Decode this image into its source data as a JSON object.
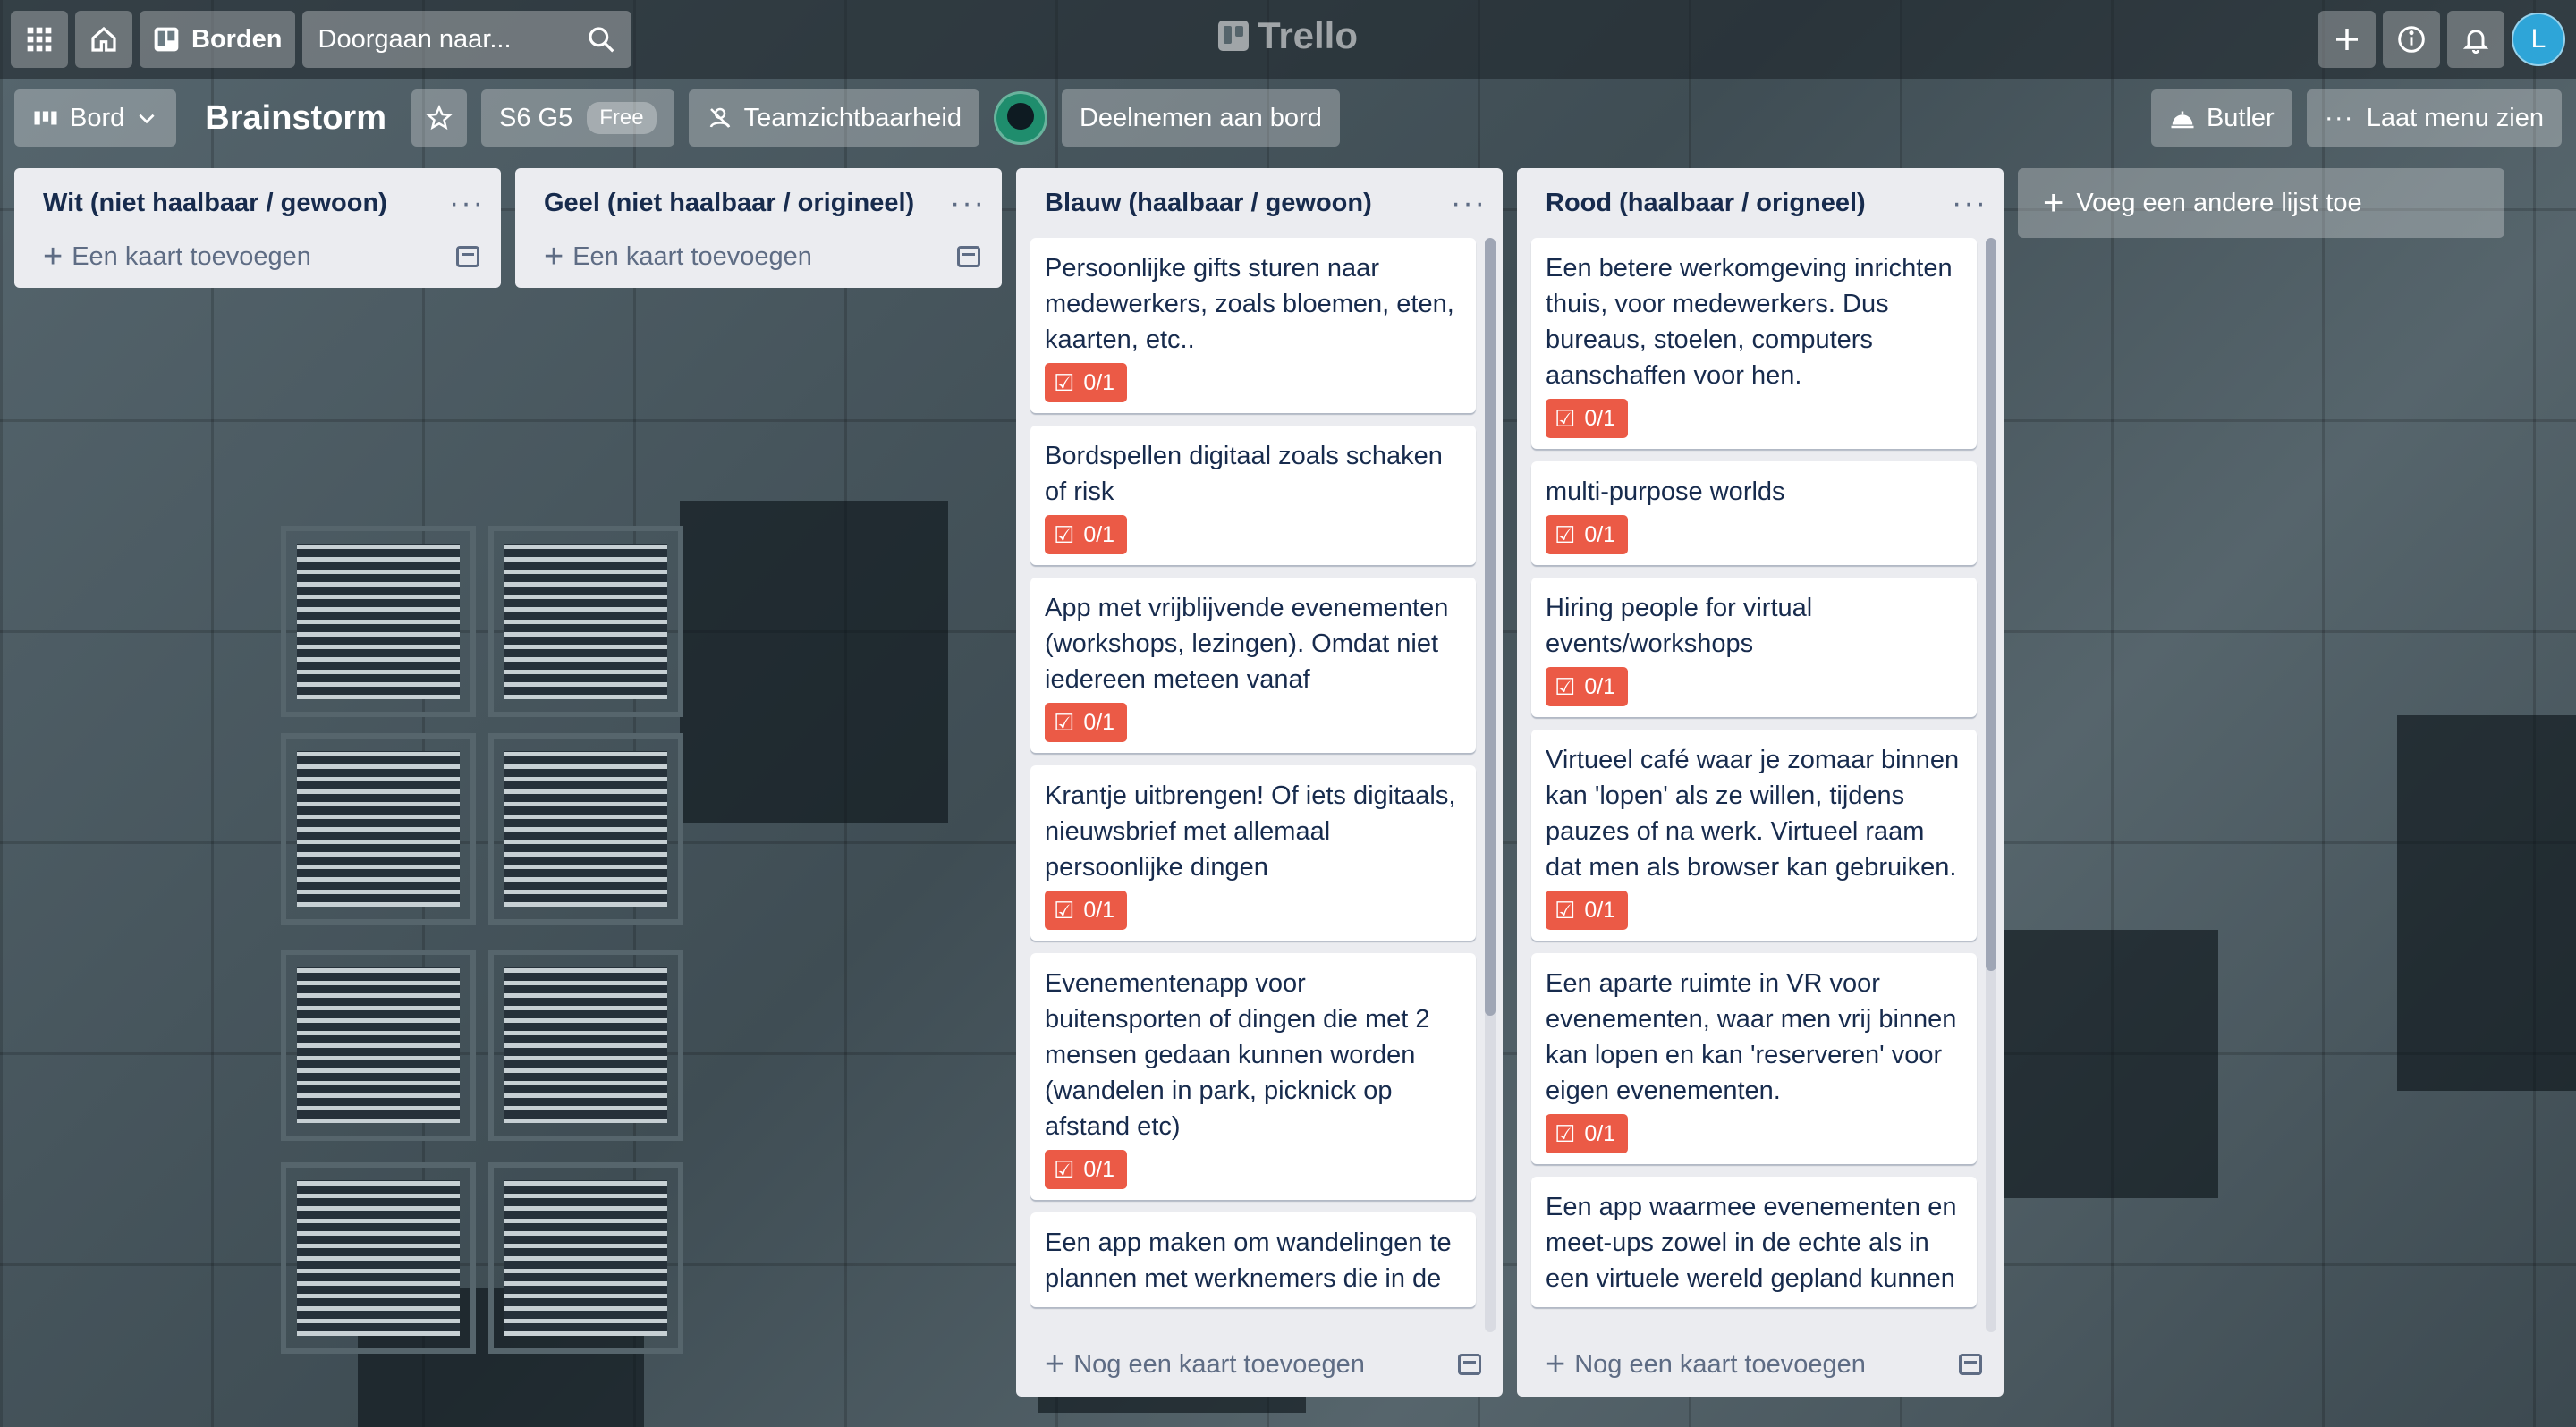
{
  "header": {
    "apps_icon": "grid-icon",
    "home_icon": "home-icon",
    "boards_label": "Borden",
    "search_placeholder": "Doorgaan naar...",
    "logo_text": "Trello",
    "avatar_initial": "L"
  },
  "board": {
    "view_label": "Bord",
    "title": "Brainstorm",
    "workspace": "S6 G5",
    "workspace_badge": "Free",
    "visibility_label": "Teamzichtbaarheid",
    "join_label": "Deelnemen aan bord",
    "butler_label": "Butler",
    "menu_label": "Laat menu zien"
  },
  "lists": [
    {
      "title": "Wit (niet haalbaar / gewoon)",
      "footer": "Een kaart toevoegen",
      "cards": []
    },
    {
      "title": "Geel (niet haalbaar / origineel)",
      "footer": "Een kaart toevoegen",
      "cards": []
    },
    {
      "title": "Blauw (haalbaar / gewoon)",
      "footer": "Nog een kaart toevoegen",
      "cards": [
        {
          "text": "Persoonlijke gifts sturen naar medewerkers, zoals bloemen, eten, kaarten, etc..",
          "checklist": "0/1"
        },
        {
          "text": "Bordspellen digitaal zoals schaken of risk",
          "checklist": "0/1"
        },
        {
          "text": "App met vrijblijvende evenementen (workshops, lezingen). Omdat niet iedereen meteen vanaf",
          "checklist": "0/1"
        },
        {
          "text": "Krantje uitbrengen! Of iets digitaals, nieuwsbrief met allemaal persoonlijke dingen",
          "checklist": "0/1"
        },
        {
          "text": "Evenementenapp voor buitensporten of dingen die met 2 mensen gedaan kunnen worden (wandelen in park, picknick op afstand etc)",
          "checklist": "0/1"
        },
        {
          "text": "Een app maken om wandelingen te plannen met werknemers die in de",
          "checklist": ""
        }
      ]
    },
    {
      "title": "Rood (haalbaar / origneel)",
      "footer": "Nog een kaart toevoegen",
      "cards": [
        {
          "text": "Een betere werkomgeving inrichten thuis, voor medewerkers. Dus bureaus, stoelen, computers aanschaffen voor hen.",
          "checklist": "0/1"
        },
        {
          "text": "multi-purpose worlds",
          "checklist": "0/1"
        },
        {
          "text": "Hiring people for virtual events/workshops",
          "checklist": "0/1"
        },
        {
          "text": "Virtueel café waar je zomaar binnen kan 'lopen' als ze willen, tijdens pauzes of na werk. Virtueel raam dat men als browser kan gebruiken.",
          "checklist": "0/1"
        },
        {
          "text": "Een aparte ruimte in VR voor evenementen, waar men vrij binnen kan lopen en kan 'reserveren' voor eigen evenementen.",
          "checklist": "0/1"
        },
        {
          "text": "Een app waarmee evenementen en meet-ups zowel in de echte als in een virtuele wereld gepland kunnen",
          "checklist": ""
        }
      ]
    }
  ],
  "add_list_label": "Voeg een andere lijst toe",
  "colors": {
    "checklist_bg": "#eb5a46",
    "list_bg": "#ebecf0",
    "avatar_bg": "#2ea5d8"
  }
}
